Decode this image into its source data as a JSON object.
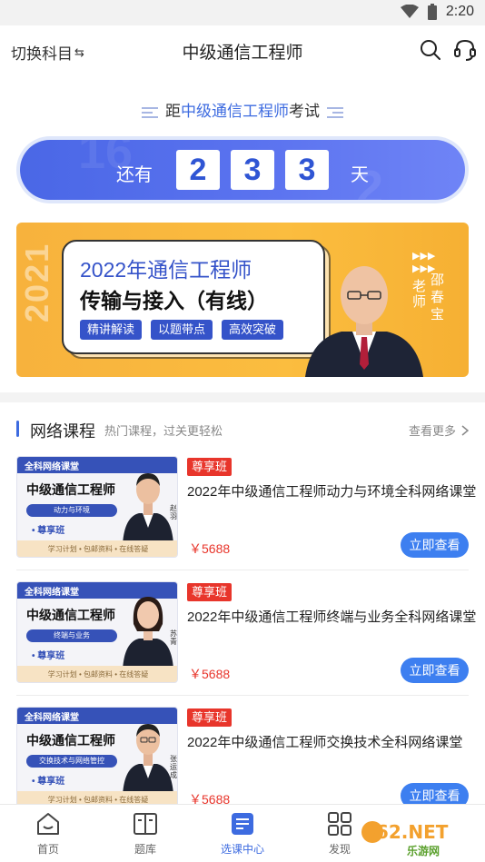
{
  "status_bar": {
    "time": "2:20"
  },
  "header": {
    "switch_label": "切换科目",
    "switch_icon": "⇆",
    "title": "中级通信工程师"
  },
  "exam_caption": {
    "prefix": "距",
    "highlight": "中级通信工程师",
    "suffix": "考试"
  },
  "countdown": {
    "prefix": "还有",
    "digits": [
      "2",
      "3",
      "3"
    ],
    "suffix": "天",
    "days": 233
  },
  "banner": {
    "year_text": "2021",
    "line1": "2022年通信工程师",
    "line2": "传输与接入（有线）",
    "tags": [
      "精讲解读",
      "以题带点",
      "高效突破"
    ],
    "teacher_title": "老师",
    "teacher_name": "邵春宝",
    "arrows": "▶▶▶"
  },
  "section": {
    "title": "网络课程",
    "subtitle": "热门课程，过关更轻松",
    "more": "查看更多"
  },
  "courses": [
    {
      "thumb_top": "全科网络课堂",
      "thumb_title": "中级通信工程师",
      "thumb_subject": "动力与环境",
      "thumb_class": "• 尊享班",
      "thumb_foot": "学习计划 • 包邮资料 • 在线答疑",
      "thumb_teacher": "赵羽",
      "badge": "尊享班",
      "name": "2022年中级通信工程师动力与环境全科网络课堂",
      "price": "￥5688",
      "button": "立即查看"
    },
    {
      "thumb_top": "全科网络课堂",
      "thumb_title": "中级通信工程师",
      "thumb_subject": "终端与业务",
      "thumb_class": "• 尊享班",
      "thumb_foot": "学习计划 • 包邮资料 • 在线答疑",
      "thumb_teacher": "苏青",
      "badge": "尊享班",
      "name": "2022年中级通信工程师终端与业务全科网络课堂",
      "price": "￥5688",
      "button": "立即查看"
    },
    {
      "thumb_top": "全科网络课堂",
      "thumb_title": "中级通信工程师",
      "thumb_subject": "交换技术与网络管控",
      "thumb_class": "• 尊享班",
      "thumb_foot": "学习计划 • 包邮资料 • 在线答疑",
      "thumb_teacher": "张运成",
      "badge": "尊享班",
      "name": "2022年中级通信工程师交换技术全科网络课堂",
      "price": "￥5688",
      "button": "立即查看"
    }
  ],
  "tabbar": [
    {
      "label": "首页",
      "icon": "home-icon"
    },
    {
      "label": "题库",
      "icon": "book-icon"
    },
    {
      "label": "选课中心",
      "icon": "course-center-icon",
      "active": true
    },
    {
      "label": "发现",
      "icon": "grid-icon"
    }
  ],
  "watermark": {
    "text": "962.NET",
    "sub": "乐游网"
  },
  "colors": {
    "accent": "#3d6be0",
    "price": "#e8352b",
    "banner": "#fbbd3f",
    "button": "#3d7ff0"
  }
}
